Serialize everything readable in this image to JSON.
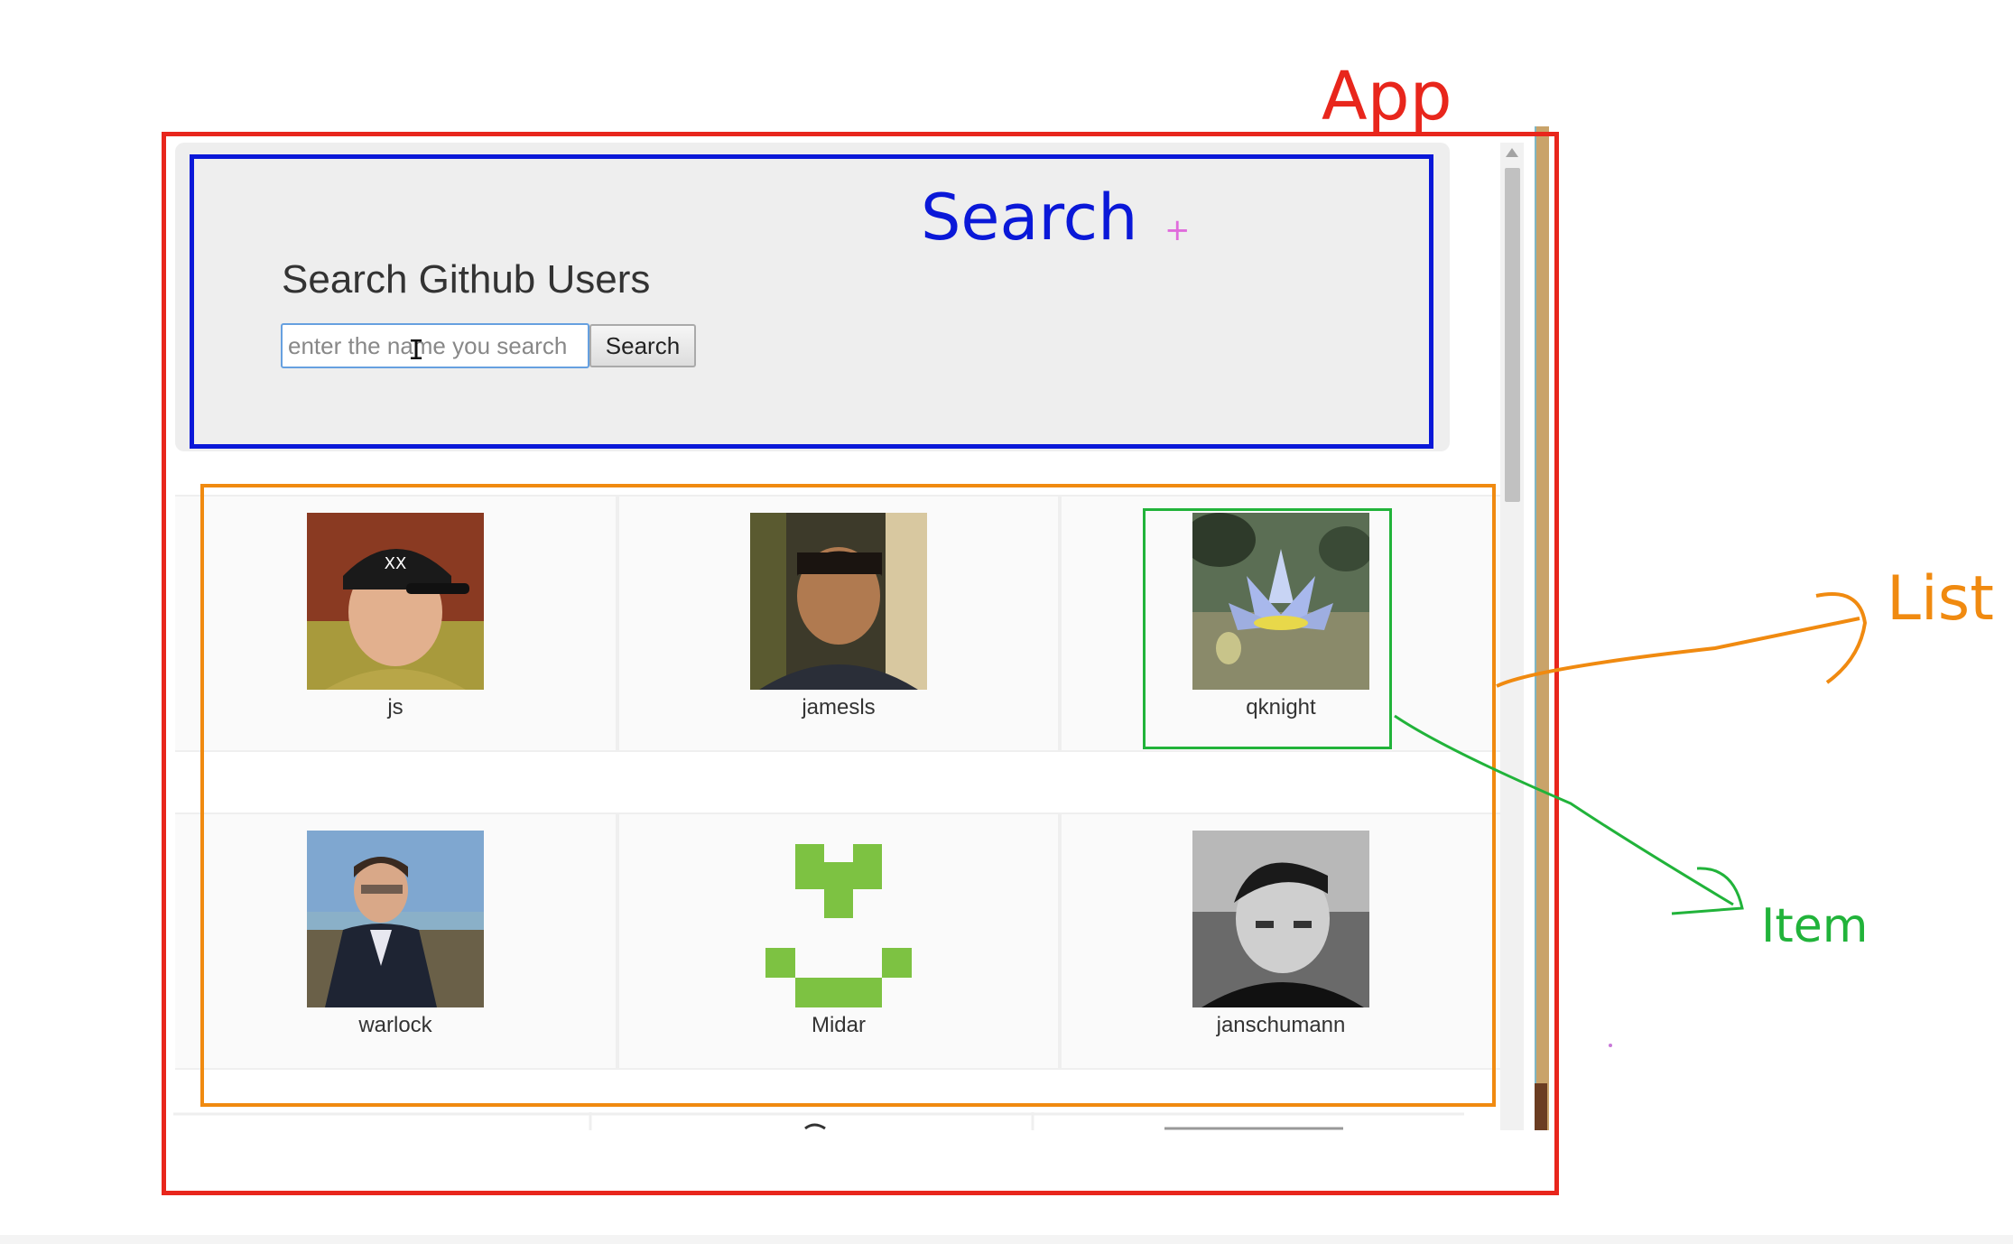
{
  "annotations": {
    "app_label": "App",
    "search_label": "Search",
    "list_label": "List",
    "item_label": "Item",
    "colors": {
      "app": "#e8261c",
      "search": "#0a18d8",
      "list": "#f08a10",
      "item": "#21b33a"
    }
  },
  "search": {
    "title": "Search Github Users",
    "input_placeholder": "enter the name you search",
    "button_label": "Search"
  },
  "list": {
    "users": [
      {
        "login": "js",
        "avatar": "photo-man-cap"
      },
      {
        "login": "jamesls",
        "avatar": "photo-man-smiling"
      },
      {
        "login": "qknight",
        "avatar": "photo-water-lily"
      },
      {
        "login": "warlock",
        "avatar": "photo-man-suit"
      },
      {
        "login": "Midar",
        "avatar": "identicon-green"
      },
      {
        "login": "janschumann",
        "avatar": "photo-man-bw"
      }
    ]
  }
}
